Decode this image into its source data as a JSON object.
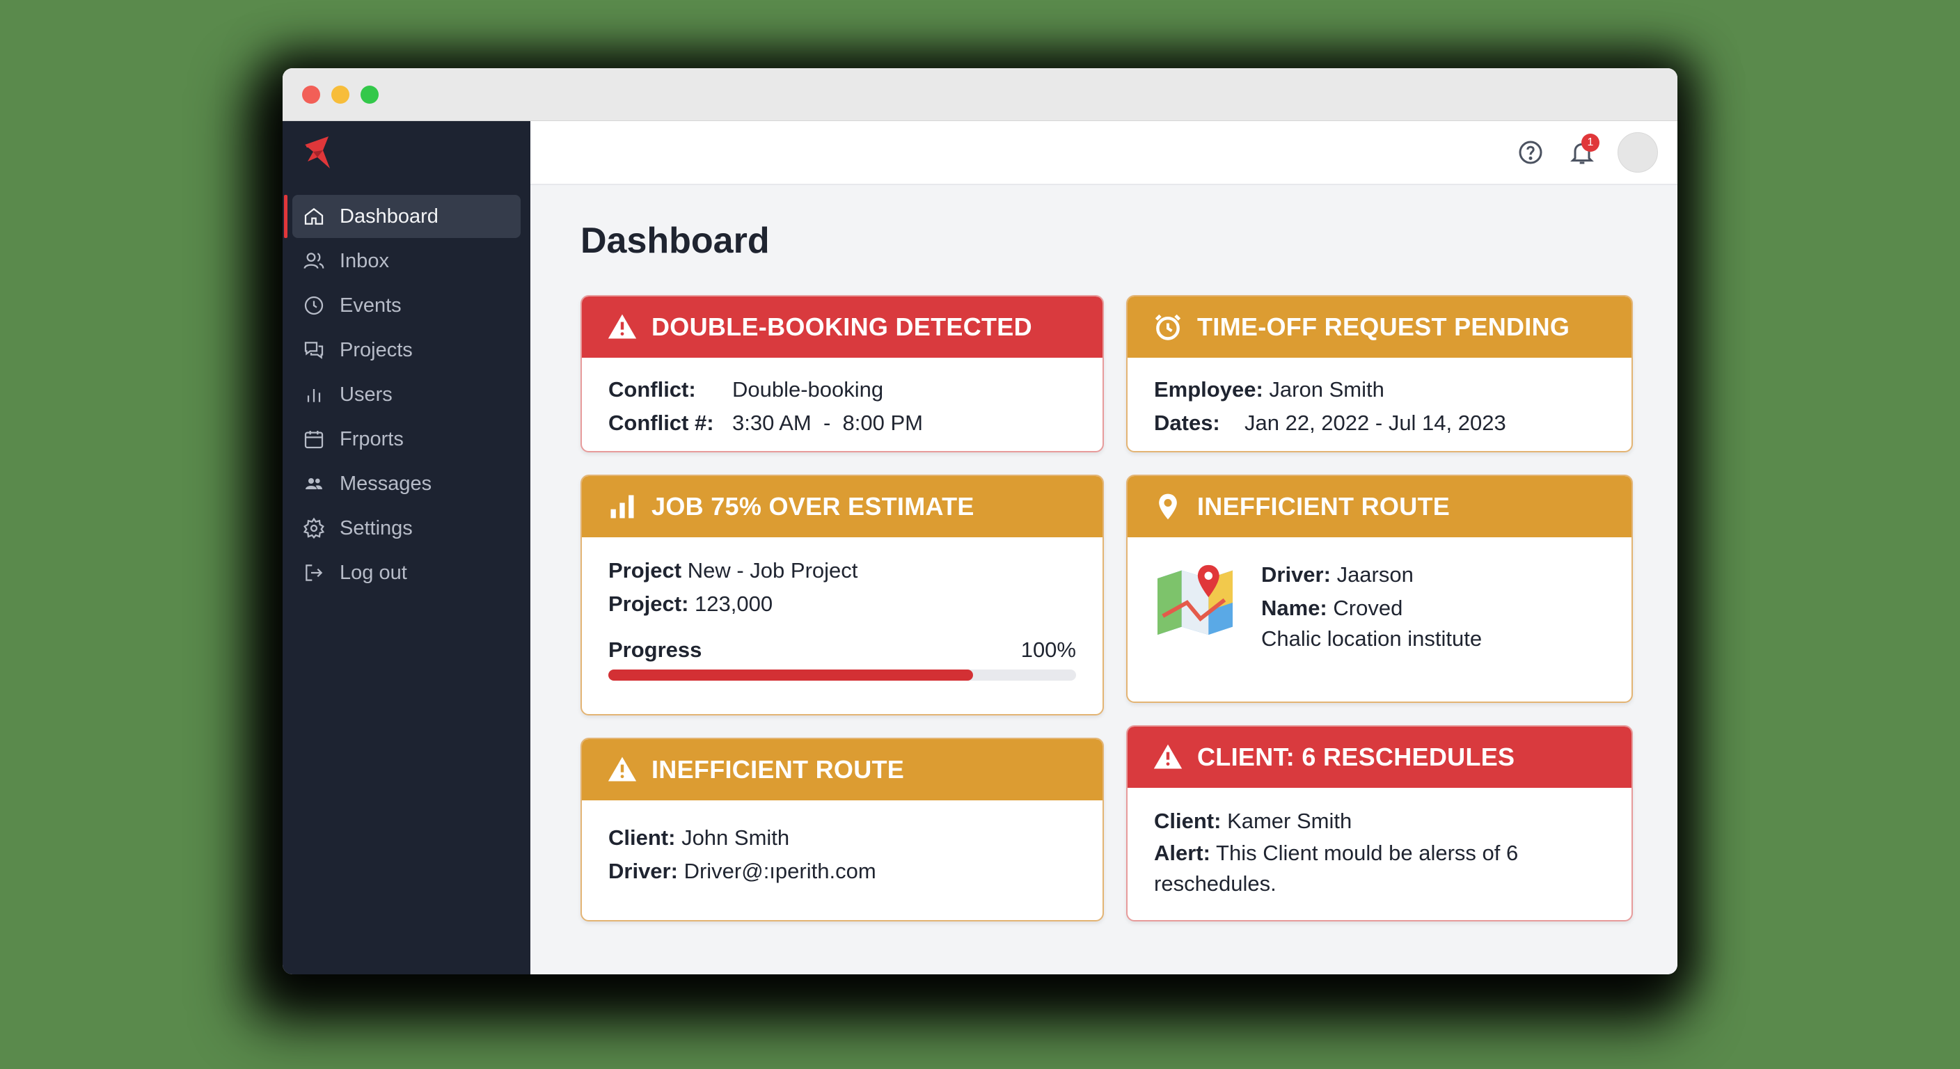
{
  "nav": {
    "items": [
      {
        "label": "Dashboard",
        "icon": "home-icon",
        "active": true
      },
      {
        "label": "Inbox",
        "icon": "users-icon"
      },
      {
        "label": "Events",
        "icon": "clock-icon"
      },
      {
        "label": "Projects",
        "icon": "chat-icon"
      },
      {
        "label": "Users",
        "icon": "bar-chart-icon"
      },
      {
        "label": "Frports",
        "icon": "calendar-icon"
      },
      {
        "label": "Messages",
        "icon": "group-icon"
      },
      {
        "label": "Settings",
        "icon": "gear-icon"
      },
      {
        "label": "Log out",
        "icon": "logout-icon"
      }
    ]
  },
  "topbar": {
    "notification_count": "1"
  },
  "page": {
    "title": "Dashboard"
  },
  "colors": {
    "alert_red": "#d93a3e",
    "alert_orange": "#dc9c32",
    "sidebar": "#1d2331",
    "progress": "#d33034"
  },
  "cards": {
    "double_booking": {
      "title": "DOUBLE-BOOKING DETECTED",
      "conflict_label": "Conflict:",
      "conflict_value": "Double-booking",
      "conflict_num_label": "Conflict #:",
      "conflict_num_value": "3:30 AM  -  8:00 PM"
    },
    "time_off": {
      "title": "TIME-OFF REQUEST PENDING",
      "employee_label": "Employee:",
      "employee_value": "Jaron Smith",
      "dates_label": "Dates:",
      "dates_value": "Jan 22, 2022 - Jul 14, 2023"
    },
    "job_over": {
      "title": "JOB 75% OVER ESTIMATE",
      "project_label": "Project",
      "project_value": "New - Job Project",
      "project2_label": "Project:",
      "project2_value": "123,000",
      "progress_label": "Progress",
      "progress_text": "100%",
      "progress_fill": 0.78
    },
    "route1": {
      "title": "INEFFICIENT ROUTE",
      "driver_label": "Driver:",
      "driver_value": "Jaarson",
      "name_label": "Name:",
      "name_value": "Croved",
      "location": "Chalic location institute"
    },
    "route2": {
      "title": "INEFFICIENT ROUTE",
      "client_label": "Client:",
      "client_value": "John Smith",
      "driver_label": "Driver:",
      "driver_value": "Driver@:ıperith.com"
    },
    "reschedules": {
      "title": "CLIENT: 6 RESCHEDULES",
      "client_label": "Client:",
      "client_value": "Kamer Smith",
      "alert_label": "Alert:",
      "alert_value": "This Client mould be alerss of 6 reschedules."
    }
  }
}
